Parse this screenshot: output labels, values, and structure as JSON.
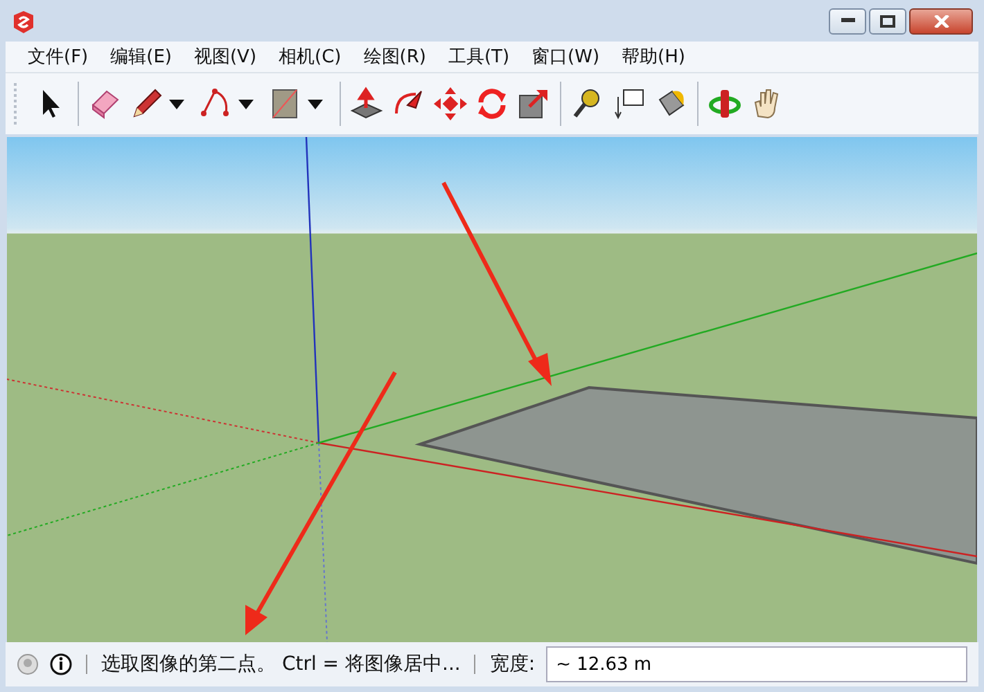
{
  "menu": [
    {
      "label": "文件(F)"
    },
    {
      "label": "编辑(E)"
    },
    {
      "label": "视图(V)"
    },
    {
      "label": "相机(C)"
    },
    {
      "label": "绘图(R)"
    },
    {
      "label": "工具(T)"
    },
    {
      "label": "窗口(W)"
    },
    {
      "label": "帮助(H)"
    }
  ],
  "toolbar": {
    "groups": [
      {
        "tools": [
          {
            "dropdown": false
          }
        ]
      },
      {
        "tools": [
          {
            "dropdown": false
          },
          {
            "dropdown": true
          },
          {
            "dropdown": true
          },
          {
            "dropdown": true
          }
        ]
      },
      {
        "tools": [
          {
            "dropdown": false
          },
          {
            "dropdown": false
          },
          {
            "dropdown": false
          },
          {
            "dropdown": false
          },
          {
            "dropdown": false
          }
        ]
      },
      {
        "tools": [
          {
            "dropdown": false
          },
          {
            "dropdown": false
          },
          {
            "dropdown": false
          }
        ]
      },
      {
        "tools": [
          {
            "dropdown": false
          },
          {
            "dropdown": false
          }
        ]
      }
    ]
  },
  "status_bar": {
    "hint": "选取图像的第二点。 Ctrl = 将图像居中...",
    "measure_label": "宽度:",
    "measure_value": "~ 12.63 m"
  }
}
